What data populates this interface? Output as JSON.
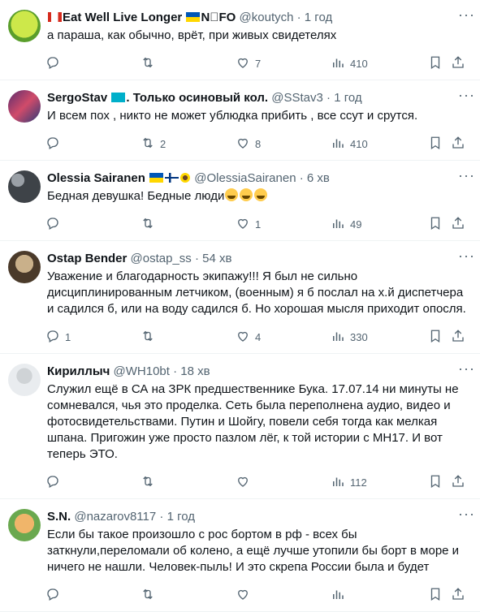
{
  "tweets": [
    {
      "name": "Eat Well Live Longer",
      "name_suffix": "N⃤FO",
      "handle": "@koutych",
      "time": "1 год",
      "text": "а параша, как обычно, врёт, при живых свидетелях",
      "reply": "",
      "retweet": "",
      "like": "7",
      "views": "410"
    },
    {
      "name": "SergoStav",
      "name_suffix": ". Только осиновый кол.",
      "handle": "@SStav3",
      "time": "1 год",
      "text": "И всем пох , никто не может ублюдка прибить , все ссут и срутся.",
      "reply": "",
      "retweet": "2",
      "like": "8",
      "views": "410"
    },
    {
      "name": "Olessia Sairanen",
      "name_suffix": "",
      "handle": "@OlessiaSairanen",
      "time": "6 хв",
      "text": "Бедная девушка! Бедные люди",
      "reply": "",
      "retweet": "",
      "like": "1",
      "views": "49"
    },
    {
      "name": "Ostap Bender",
      "name_suffix": "",
      "handle": "@ostap_ss",
      "time": "54 хв",
      "text": "Уважение и благодарность экипажу!!! Я был не сильно дисциплинированным летчиком, (военным) я б послал на х.й диспетчера и садился б, или на воду садился б. Но хорошая мысля приходит опосля.",
      "reply": "1",
      "retweet": "",
      "like": "4",
      "views": "330"
    },
    {
      "name": "Кириллыч",
      "name_suffix": "",
      "handle": "@WH10bt",
      "time": "18 хв",
      "text": "Служил ещё в СА на ЗРК предшественнике Бука. 17.07.14 ни минуты не сомневался, чья это проделка. Сеть была переполнена аудио, видео и фотосвидетельствами. Путин и Шойгу, повели себя тогда как мелкая шпана. Пригожин уже просто пазлом  лёг, к той истории с МН17. И вот теперь ЭТО.",
      "reply": "",
      "retweet": "",
      "like": "",
      "views": "112"
    },
    {
      "name": "S.N.",
      "name_suffix": "",
      "handle": "@nazarov8117",
      "time": "1 год",
      "text": "Если бы такое произошло с рос бортом в рф - всех бы заткнули,переломали об колено, а ещё лучше утопили бы борт в море и ничего не нашли. Человек-пыль! И это скрепа России была и будет",
      "reply": "",
      "retweet": "",
      "like": "",
      "views": ""
    }
  ],
  "colors": {
    "muted": "#536471",
    "border": "#eff3f4",
    "text": "#0f1419"
  },
  "icons": [
    "reply-icon",
    "retweet-icon",
    "like-icon",
    "views-icon",
    "bookmark-icon",
    "share-icon",
    "more-icon"
  ]
}
